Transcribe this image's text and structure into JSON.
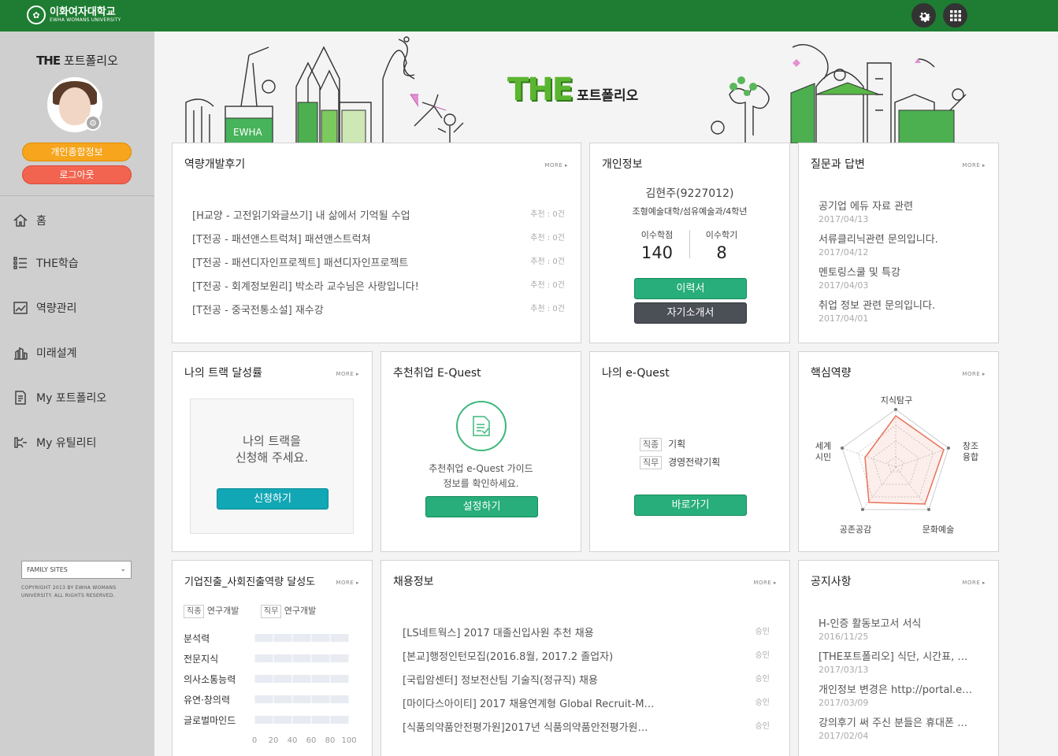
{
  "header": {
    "logo_korean": "이화여자대학교",
    "logo_english": "EWHA WOMANS UNIVERSITY",
    "settings_icon": "gear-icon",
    "apps_icon": "grid-icon"
  },
  "sidebar": {
    "title_the": "THE",
    "title_rest": "포트폴리오",
    "info_button": "개인종합정보",
    "logout_button": "로그아웃",
    "nav": [
      {
        "label": "홈",
        "icon": "home-icon"
      },
      {
        "label": "THE학습",
        "icon": "list-icon"
      },
      {
        "label": "역량관리",
        "icon": "chart-icon"
      },
      {
        "label": "미래설계",
        "icon": "building-icon"
      },
      {
        "label": "My 포트폴리오",
        "icon": "document-icon"
      },
      {
        "label": "My 유틸리티",
        "icon": "tools-icon"
      }
    ],
    "family_sites": "FAMILY SITES",
    "copyright": "COPYRIGHT 2013 BY EWHA WOMANS UNIVERSITY. ALL RIGHTS RESERVED."
  },
  "banner": {
    "title_the": "THE",
    "title_rest": "포트폴리오",
    "building_label": "EWHA"
  },
  "more_label": "MORE ▸",
  "reviews": {
    "title": "역량개발후기",
    "items": [
      {
        "text": "[H교양 - 고전읽기와글쓰기] 내 삶에서 기억될 수업",
        "rec": "추천 : 0건"
      },
      {
        "text": "[T전공 - 패션앤스트럭쳐] 패션앤스트럭쳐",
        "rec": "추천 : 0건"
      },
      {
        "text": "[T전공 - 패션디자인프로젝트] 패션디자인프로젝트",
        "rec": "추천 : 0건"
      },
      {
        "text": "[T전공 - 회계정보원리] 박소라 교수님은 사랑입니다!",
        "rec": "추천 : 0건"
      },
      {
        "text": "[T전공 - 중국전통소설] 재수강",
        "rec": "추천 : 0건"
      }
    ]
  },
  "profile": {
    "title": "개인정보",
    "name": "김현주(9227012)",
    "dept": "조형예술대학/섬유예술과/4학년",
    "credits_label": "이수학점",
    "credits_value": "140",
    "semesters_label": "이수학기",
    "semesters_value": "8",
    "resume_button": "이력서",
    "intro_button": "자기소개서"
  },
  "qa": {
    "title": "질문과 답변",
    "items": [
      {
        "text": "공기업 에듀 자료 관련",
        "date": "2017/04/13"
      },
      {
        "text": "서류클리닉관련 문의입니다.",
        "date": "2017/04/12"
      },
      {
        "text": "멘토링스쿨 및 특강",
        "date": "2017/04/03"
      },
      {
        "text": "취업 정보 관련 문의입니다.",
        "date": "2017/04/01"
      }
    ]
  },
  "track": {
    "title": "나의 트랙 달성률",
    "message_line1": "나의 트랙을",
    "message_line2": "신청해 주세요.",
    "button": "신청하기"
  },
  "equest": {
    "title": "추천취업 E-Quest",
    "guide_line1": "추천취업 e-Quest 가이드",
    "guide_line2": "정보를 확인하세요.",
    "button": "설정하기"
  },
  "my_equest": {
    "title": "나의 e-Quest",
    "job_type_tag": "직종",
    "job_type": "기획",
    "job_role_tag": "직무",
    "job_role": "경영전략기획",
    "button": "바로가기"
  },
  "core": {
    "title": "핵심역량",
    "axes": [
      "지식탐구",
      "창조\n융합",
      "문화예술",
      "공존공감",
      "세계\n시민"
    ]
  },
  "career": {
    "title": "기업진출_사회진출역량 달성도",
    "tag1": "직종",
    "tag1_value": "연구개발",
    "tag2": "직무",
    "tag2_value": "연구개발"
  },
  "chart_data": {
    "type": "bar",
    "categories": [
      "분석력",
      "전문지식",
      "의사소통능력",
      "유연·창의력",
      "글로벌마인드"
    ],
    "values": [
      0,
      0,
      0,
      0,
      0
    ],
    "xlim": [
      0,
      100
    ],
    "ticks": [
      "0",
      "20",
      "40",
      "60",
      "80",
      "100"
    ]
  },
  "jobs": {
    "title": "채용정보",
    "items": [
      {
        "text": "[LS네트웍스] 2017 대졸신입사원 추천 채용",
        "status": "승인"
      },
      {
        "text": "[본교]행정인턴모집(2016.8월, 2017.2 졸업자)",
        "status": "승인"
      },
      {
        "text": "[국립암센터] 정보전산팀 기술직(정규직) 채용",
        "status": "승인"
      },
      {
        "text": "[마이다스아이티] 2017 채용연계형 Global Recruit-M…",
        "status": "승인"
      },
      {
        "text": "[식품의약품안전평가원]2017년 식품의약품안전평가원…",
        "status": "승인"
      }
    ]
  },
  "notice": {
    "title": "공지사항",
    "items": [
      {
        "text": "H-인증 활동보고서 서식",
        "date": "2016/11/25"
      },
      {
        "text": "[THE포트폴리오] 식단, 시간표, …",
        "date": "2017/03/13"
      },
      {
        "text": "개인정보 변경은 http://portal.e…",
        "date": "2017/03/09"
      },
      {
        "text": "강의후기 써 주신 분들은 휴대폰 …",
        "date": "2017/02/04"
      }
    ]
  },
  "colors": {
    "header": "#1e7d32",
    "green_button": "#27ae7a",
    "teal_button": "#12a7b5",
    "dark_button": "#4b4f56",
    "radar": "#e8735a"
  }
}
